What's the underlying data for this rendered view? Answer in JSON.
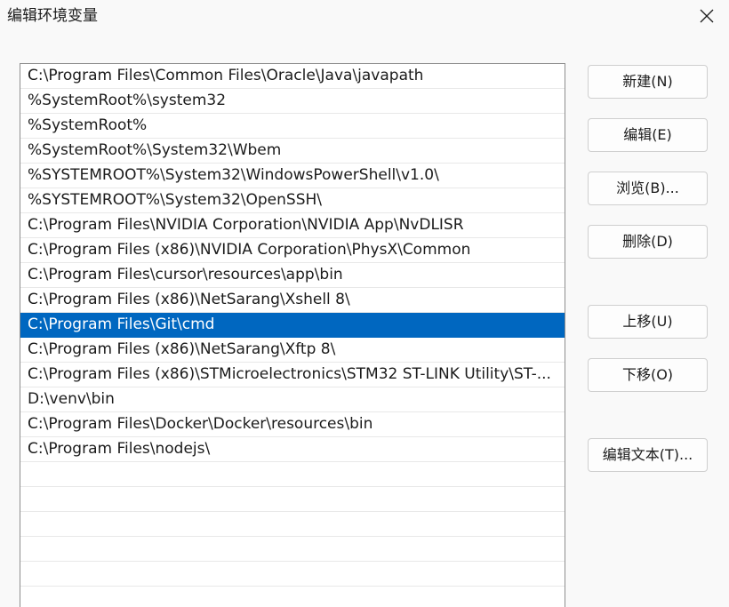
{
  "window": {
    "title": "编辑环境变量"
  },
  "icons": {
    "close": "close-icon"
  },
  "path_list": {
    "selected_index": 10,
    "items": [
      "C:\\Program Files\\Common Files\\Oracle\\Java\\javapath",
      "%SystemRoot%\\system32",
      "%SystemRoot%",
      "%SystemRoot%\\System32\\Wbem",
      "%SYSTEMROOT%\\System32\\WindowsPowerShell\\v1.0\\",
      "%SYSTEMROOT%\\System32\\OpenSSH\\",
      "C:\\Program Files\\NVIDIA Corporation\\NVIDIA App\\NvDLISR",
      "C:\\Program Files (x86)\\NVIDIA Corporation\\PhysX\\Common",
      "C:\\Program Files\\cursor\\resources\\app\\bin",
      "C:\\Program Files (x86)\\NetSarang\\Xshell 8\\",
      "C:\\Program Files\\Git\\cmd",
      "C:\\Program Files (x86)\\NetSarang\\Xftp 8\\",
      "C:\\Program Files (x86)\\STMicroelectronics\\STM32 ST-LINK Utility\\ST-...",
      "D:\\venv\\bin",
      "C:\\Program Files\\Docker\\Docker\\resources\\bin",
      "C:\\Program Files\\nodejs\\",
      "",
      "",
      "",
      "",
      "",
      ""
    ]
  },
  "buttons": {
    "new": "新建(N)",
    "edit": "编辑(E)",
    "browse": "浏览(B)...",
    "delete": "删除(D)",
    "move_up": "上移(U)",
    "move_down": "下移(O)",
    "edit_text": "编辑文本(T)..."
  },
  "colors": {
    "selection": "#0067c0",
    "background": "#f9f9f9"
  }
}
